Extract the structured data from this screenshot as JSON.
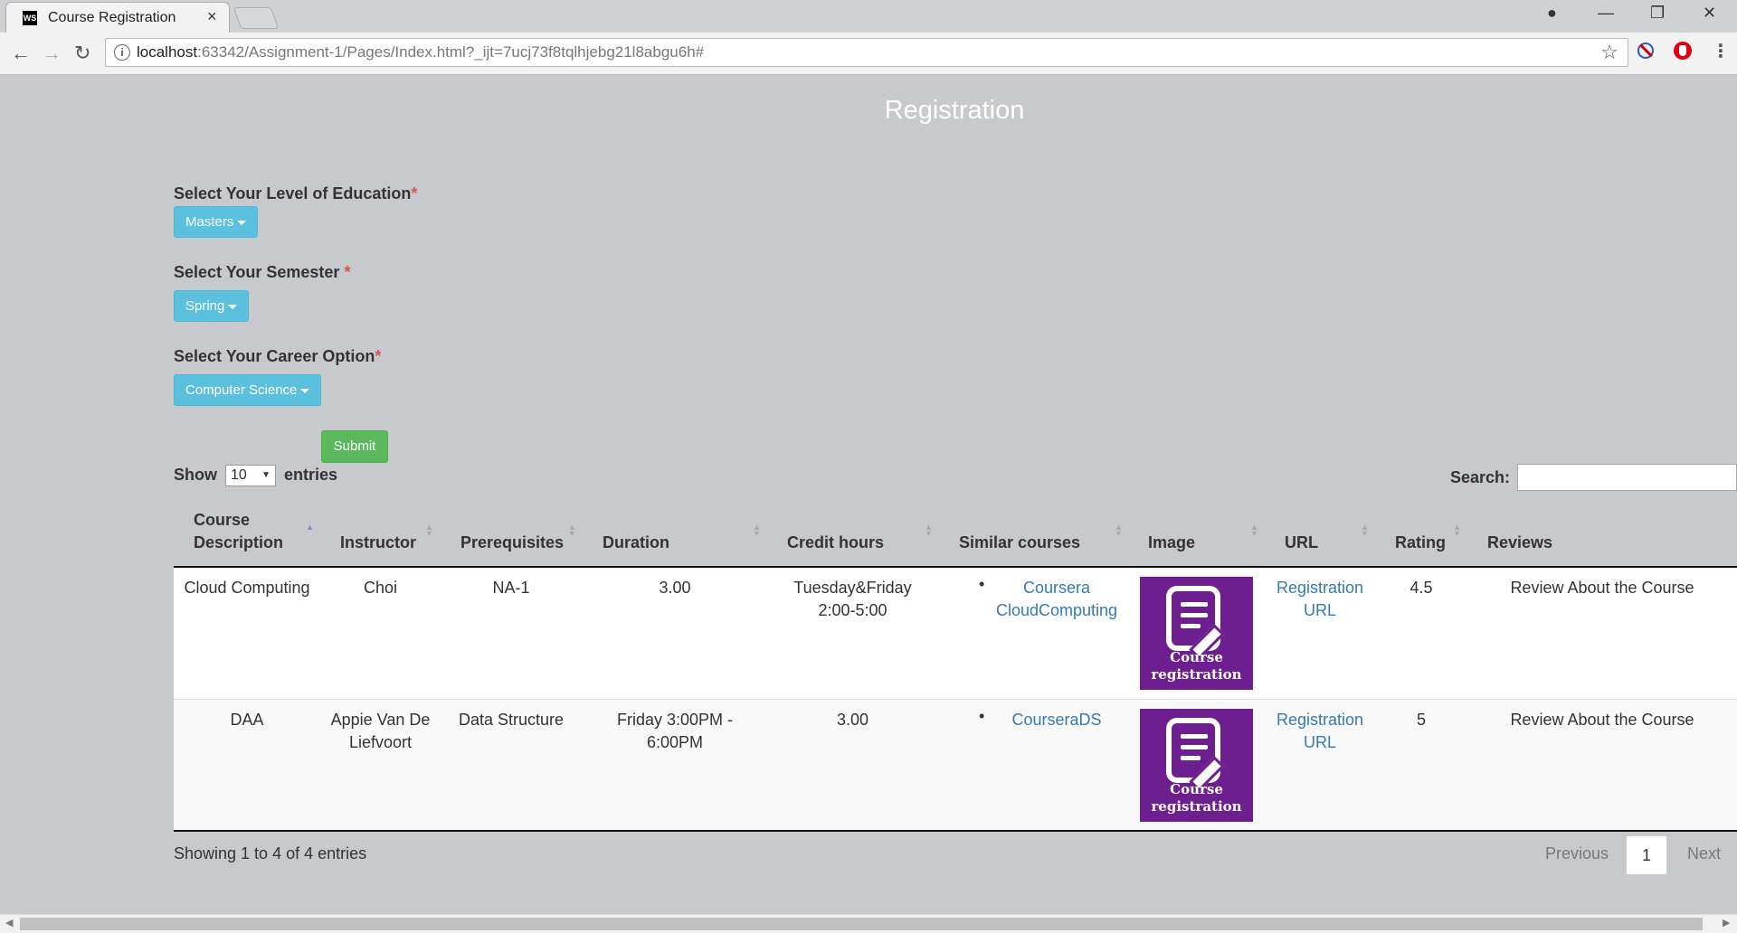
{
  "browser": {
    "tab_title": "Course Registration",
    "favicon_text": "WS",
    "tab_close": "×",
    "url_host": "localhost",
    "url_rest": ":63342/Assignment-1/Pages/Index.html?_ijt=7ucj73f8tqlhjebg21l8abgu6h#",
    "nav": {
      "back": "←",
      "forward": "→",
      "reload": "↻"
    },
    "window": {
      "minimize": "—",
      "maximize": "❐",
      "close": "✕",
      "profile": "●"
    },
    "star": "☆",
    "menu": "⋮"
  },
  "page": {
    "title": "Registration"
  },
  "form": {
    "education": {
      "label": "Select Your Level of Education",
      "required": "*",
      "value": "Masters"
    },
    "semester": {
      "label": "Select Your Semester ",
      "required": "*",
      "value": "Spring"
    },
    "career": {
      "label": "Select Your Career Option",
      "required": "*",
      "value": "Computer Science"
    },
    "submit": "Submit"
  },
  "table_controls": {
    "show": "Show",
    "length_value": "10",
    "entries": "entries",
    "search_label": "Search:",
    "search_value": ""
  },
  "table": {
    "headers": {
      "course_line1": "Course",
      "course_line2": "Description",
      "instructor": "Instructor",
      "prerequisites": "Prerequisites",
      "duration": "Duration",
      "credit": "Credit hours",
      "similar": "Similar courses",
      "image": "Image",
      "url": "URL",
      "rating": "Rating",
      "reviews": "Reviews"
    },
    "rows": [
      {
        "course": "Cloud Computing",
        "instructor_l1": "Choi",
        "instructor_l2": "",
        "prereq": "NA-1",
        "duration_l1": "3.00",
        "duration_l2": "",
        "credit_l1": "Tuesday&Friday",
        "credit_l2": "2:00-5:00",
        "similar_l1": "Coursera",
        "similar_l2": "CloudComputing",
        "url_l1": "Registration",
        "url_l2": "URL",
        "rating": "4.5",
        "review": "Review About the Course",
        "img_l1": "Course",
        "img_l2": "registration"
      },
      {
        "course": "DAA",
        "instructor_l1": "Appie Van De",
        "instructor_l2": "Liefvoort",
        "prereq": "Data Structure",
        "duration_l1": "Friday 3:00PM -",
        "duration_l2": "6:00PM",
        "credit_l1": "3.00",
        "credit_l2": "",
        "similar_l1": "CourseraDS",
        "similar_l2": "",
        "url_l1": "Registration",
        "url_l2": "URL",
        "rating": "5",
        "review": "Review About the Course",
        "img_l1": "Course",
        "img_l2": "registration"
      }
    ]
  },
  "footer": {
    "info": "Showing 1 to 4 of 4 entries",
    "previous": "Previous",
    "page": "1",
    "next": "Next"
  },
  "colors": {
    "page_bg": "#c7c9cc",
    "info_button": "#5bc0de",
    "success_button": "#5cb85c",
    "link": "#337ab7",
    "required": "#d9534f",
    "course_image": "#6d1f90"
  }
}
